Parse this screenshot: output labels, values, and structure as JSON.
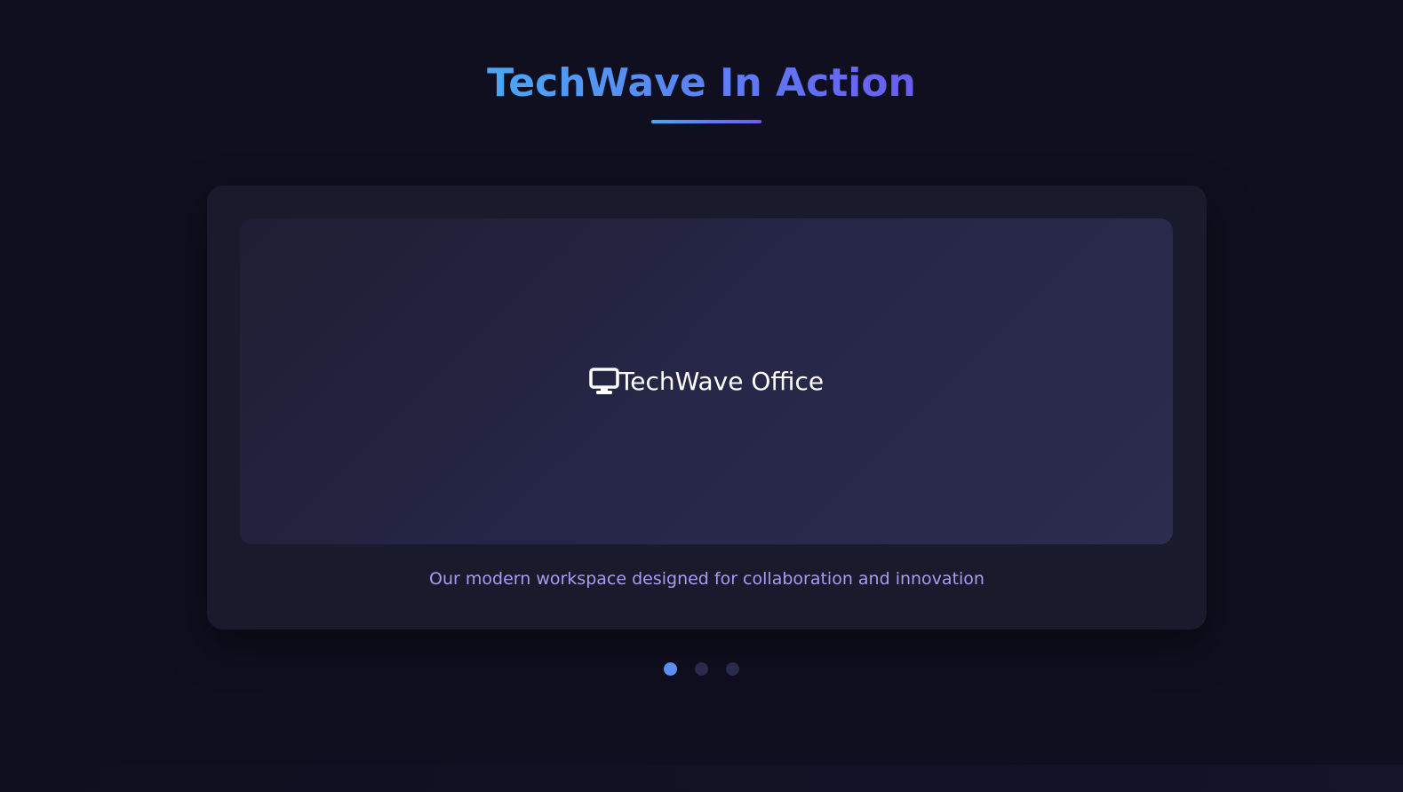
{
  "section": {
    "title": "TechWave In Action"
  },
  "carousel": {
    "active_index": 0,
    "slide": {
      "icon": "desktop-monitor-icon",
      "label": "TechWave Office",
      "caption": "Our modern workspace designed for collaboration and innovation"
    },
    "dot_count": 3
  },
  "colors": {
    "background": "#0f0f1f",
    "card": "#1a1a2d",
    "title_gradient_start": "#4aa8f5",
    "title_gradient_end": "#6b5cf2",
    "caption": "#a99cf0",
    "dot_active": "#5b8ff5",
    "dot_inactive": "#2a2a4c"
  }
}
